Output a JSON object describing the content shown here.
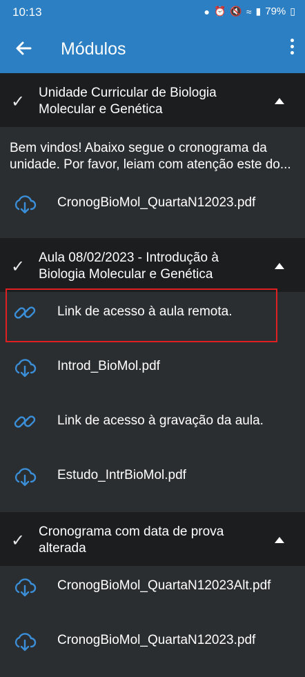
{
  "status_bar": {
    "time": "10:13",
    "battery": "79%"
  },
  "app_bar": {
    "title": "Módulos"
  },
  "sections": [
    {
      "title": " Unidade Curricular de Biologia Molecular e Genética",
      "description": "Bem vindos! Abaixo segue o cronograma da unidade. Por favor, leiam com atenção este do...",
      "items": [
        {
          "icon": "cloud-download-icon",
          "label": "CronogBioMol_QuartaN12023.pdf"
        }
      ]
    },
    {
      "title": "Aula 08/02/2023 - Introdução à Biologia Molecular e Genética",
      "items": [
        {
          "icon": "link-icon",
          "label": "Link de acesso à aula remota."
        },
        {
          "icon": "cloud-download-icon",
          "label": "Introd_BioMol.pdf"
        },
        {
          "icon": "link-icon",
          "label": "Link de acesso à gravação da aula."
        },
        {
          "icon": "cloud-download-icon",
          "label": "Estudo_IntrBioMol.pdf"
        }
      ]
    },
    {
      "title": "Cronograma com data de prova alterada",
      "items": [
        {
          "icon": "cloud-download-icon",
          "label": "CronogBioMol_QuartaN12023Alt.pdf"
        },
        {
          "icon": "cloud-download-icon",
          "label": "CronogBioMol_QuartaN12023.pdf"
        }
      ]
    }
  ],
  "colors": {
    "accent": "#2b7fc2",
    "background": "#2b2e31",
    "section_header": "#1b1d1f",
    "icon_blue": "#3a8fd8",
    "highlight": "#e02020"
  }
}
